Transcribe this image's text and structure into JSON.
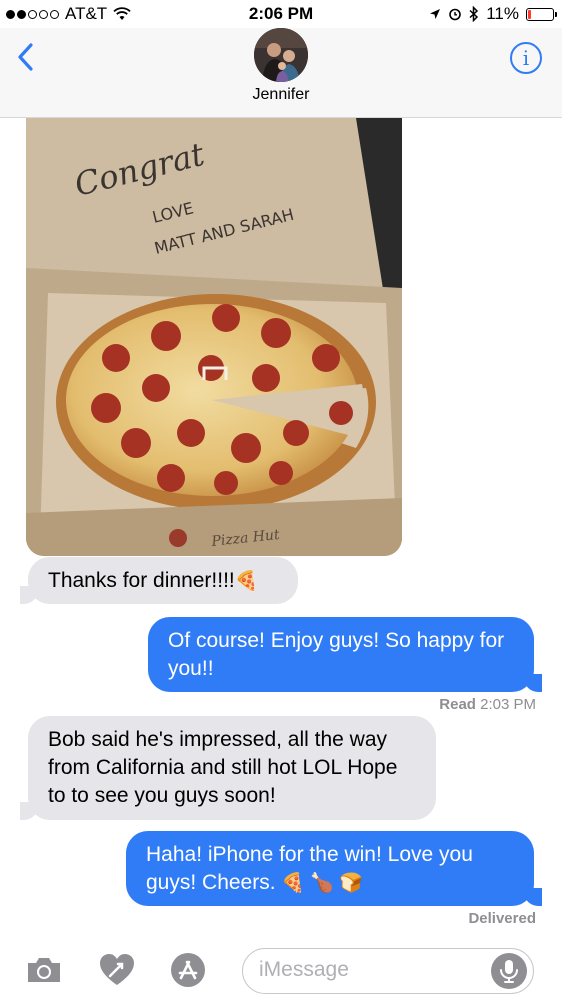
{
  "status_bar": {
    "carrier": "AT&T",
    "time": "2:06 PM",
    "battery_percent": "11%",
    "battery_level": 0.11,
    "icons": [
      "signal-icon",
      "wifi-icon",
      "location-icon",
      "alarm-icon",
      "bluetooth-icon",
      "battery-icon"
    ]
  },
  "header": {
    "contact_name": "Jennifer",
    "back_icon": "chevron-left-icon",
    "info_icon": "info-icon",
    "accent_color": "#2f7cf6"
  },
  "conversation": {
    "photo": {
      "lid_text_line1": "Congrat",
      "lid_text_line2": "LOVE",
      "lid_text_line3": "MATT AND SARAH",
      "box_brand": "Pizza Hut"
    },
    "messages": [
      {
        "direction": "received",
        "text": "Thanks for dinner!!!!",
        "emoji": "🍕"
      },
      {
        "direction": "sent",
        "text": "Of course!  Enjoy guys!  So happy for you!!"
      },
      {
        "direction": "received",
        "text": "Bob said he's impressed, all the way from California and still hot LOL Hope to to see you guys soon!"
      },
      {
        "direction": "sent",
        "text": "Haha!  iPhone for the win!  Love you guys!  Cheers.",
        "emoji": "🍕 🍗 🍞"
      }
    ],
    "read_label": "Read",
    "read_time": "2:03 PM",
    "delivered_label": "Delivered",
    "sent_bubble_color": "#2f7cf6",
    "received_bubble_color": "#e5e5ea"
  },
  "input_bar": {
    "placeholder": "iMessage",
    "value": "",
    "icons": [
      "camera-icon",
      "digital-touch-icon",
      "app-store-icon",
      "microphone-icon"
    ]
  }
}
